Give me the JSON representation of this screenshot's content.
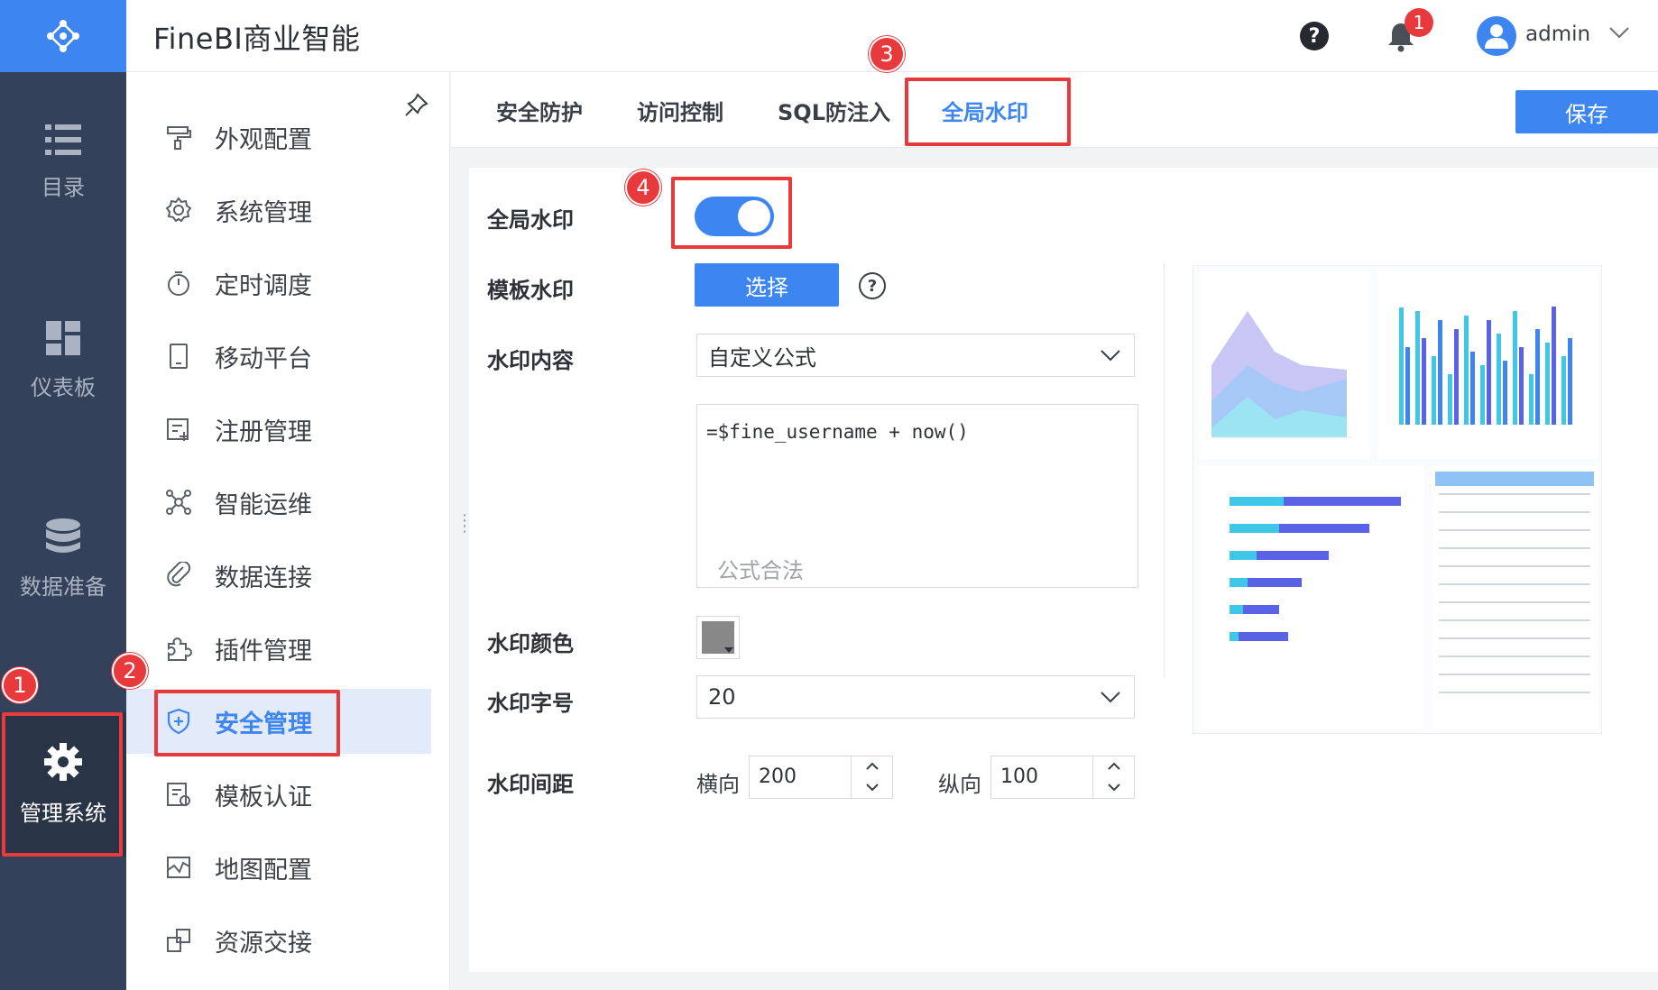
{
  "app": {
    "title": "FineBI商业智能"
  },
  "rail": {
    "items": [
      {
        "label": "目录",
        "icon": "list-icon"
      },
      {
        "label": "仪表板",
        "icon": "dashboard-icon"
      },
      {
        "label": "数据准备",
        "icon": "database-icon"
      },
      {
        "label": "管理系统",
        "icon": "gear-icon",
        "active": true
      }
    ]
  },
  "header": {
    "help": "?",
    "notification_count": "1",
    "username": "admin"
  },
  "sidebar": {
    "items": [
      {
        "label": "外观配置",
        "icon": "paint-icon"
      },
      {
        "label": "系统管理",
        "icon": "settings-icon"
      },
      {
        "label": "定时调度",
        "icon": "timer-icon"
      },
      {
        "label": "移动平台",
        "icon": "tablet-icon"
      },
      {
        "label": "注册管理",
        "icon": "register-icon"
      },
      {
        "label": "智能运维",
        "icon": "network-icon"
      },
      {
        "label": "数据连接",
        "icon": "link-icon"
      },
      {
        "label": "插件管理",
        "icon": "puzzle-icon"
      },
      {
        "label": "安全管理",
        "icon": "shield-icon",
        "active": true
      },
      {
        "label": "模板认证",
        "icon": "certificate-icon"
      },
      {
        "label": "地图配置",
        "icon": "map-icon"
      },
      {
        "label": "资源交接",
        "icon": "transfer-icon"
      }
    ]
  },
  "tabs": {
    "items": [
      {
        "label": "安全防护"
      },
      {
        "label": "访问控制"
      },
      {
        "label": "SQL防注入"
      },
      {
        "label": "全局水印",
        "active": true
      }
    ],
    "save_label": "保存"
  },
  "form": {
    "global_watermark": {
      "label": "全局水印",
      "enabled": true
    },
    "template_watermark": {
      "label": "模板水印",
      "button": "选择",
      "help": "?"
    },
    "content": {
      "label": "水印内容",
      "selected": "自定义公式"
    },
    "formula": {
      "code": "=$fine_username + now()",
      "status": "公式合法"
    },
    "color": {
      "label": "水印颜色",
      "value": "#888888"
    },
    "font_size": {
      "label": "水印字号",
      "selected": "20"
    },
    "spacing": {
      "label": "水印间距",
      "horizontal_label": "横向",
      "horizontal_value": "200",
      "vertical_label": "纵向",
      "vertical_value": "100"
    }
  },
  "annotations": {
    "one": "1",
    "two": "2",
    "three": "3",
    "four": "4"
  },
  "colors": {
    "accent": "#3d86f2",
    "rail_bg": "#33425a",
    "annotation": "#e8393d"
  }
}
